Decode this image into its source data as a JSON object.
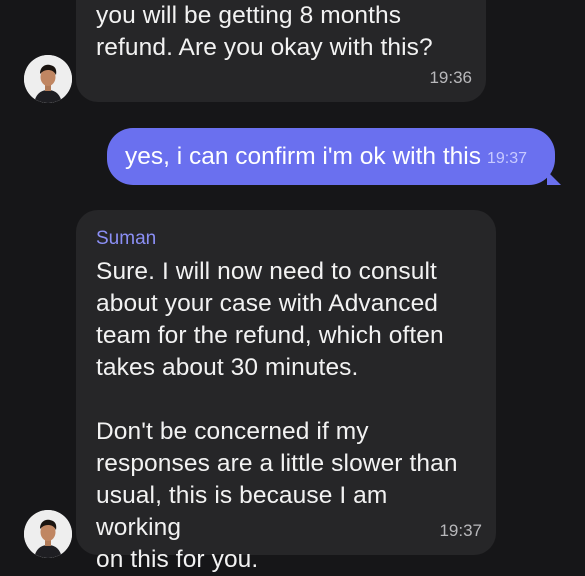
{
  "messages": [
    {
      "direction": "incoming",
      "text": "you will be getting 8 months\nrefund. Are you okay with this?",
      "time": "19:36"
    },
    {
      "direction": "outgoing",
      "text": "yes, i can confirm i'm ok with this",
      "time": "19:37"
    },
    {
      "direction": "incoming",
      "sender": "Suman",
      "text": "Sure. I will now need to consult\nabout your case with Advanced\nteam for the refund, which often\ntakes about 30 minutes.\n\nDon't be concerned if my\nresponses are a little slower than\nusual, this is because I am working\non this for you.",
      "time": "19:37"
    }
  ],
  "colors": {
    "background": "#161618",
    "incoming_bubble": "#262628",
    "outgoing_bubble": "#6a70ef",
    "sender_name": "#8b8ff5"
  },
  "icons": {
    "avatar": "agent-avatar-icon"
  }
}
